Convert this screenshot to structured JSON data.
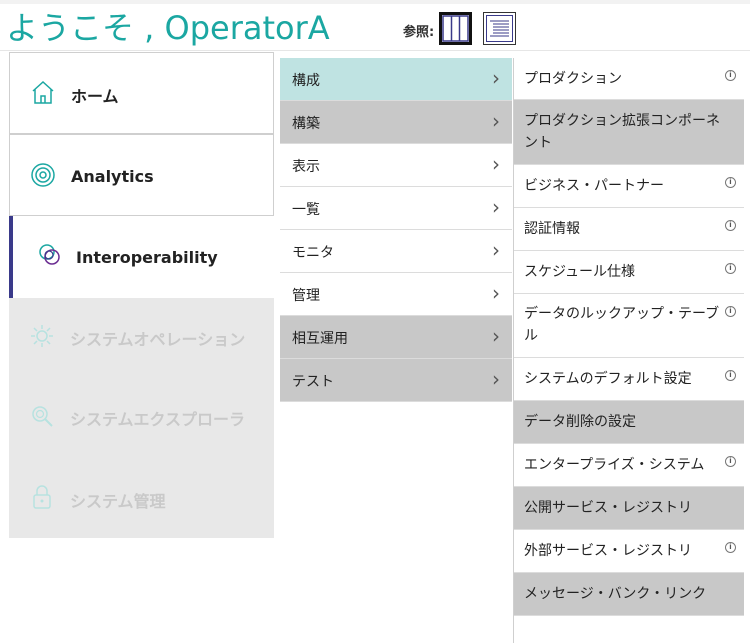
{
  "header": {
    "welcome": "ようこそ , OperatorA",
    "view_label": "参照:",
    "view_columns_icon": "columns-view-icon",
    "view_list_icon": "list-view-icon"
  },
  "left_menu": {
    "items": [
      {
        "label": "ホーム",
        "icon": "home-icon",
        "state": "enabled"
      },
      {
        "label": "Analytics",
        "icon": "analytics-target-icon",
        "state": "enabled"
      },
      {
        "label": "Interoperability",
        "icon": "interoperability-rings-icon",
        "state": "selected"
      },
      {
        "label": "システムオペレーション",
        "icon": "gear-icon",
        "state": "disabled"
      },
      {
        "label": "システムエクスプローラ",
        "icon": "magnifier-icon",
        "state": "disabled"
      },
      {
        "label": "システム管理",
        "icon": "lock-icon",
        "state": "disabled"
      }
    ]
  },
  "middle_menu": {
    "items": [
      {
        "label": "構成",
        "state": "selected"
      },
      {
        "label": "構築",
        "state": "gray"
      },
      {
        "label": "表示",
        "state": "white"
      },
      {
        "label": "一覧",
        "state": "white"
      },
      {
        "label": "モニタ",
        "state": "white"
      },
      {
        "label": "管理",
        "state": "white"
      },
      {
        "label": "相互運用",
        "state": "gray"
      },
      {
        "label": "テスト",
        "state": "gray"
      }
    ],
    "chevron": "›"
  },
  "right_menu": {
    "info_glyph": "i",
    "items": [
      {
        "label": "プロダクション",
        "state": "white",
        "info": true
      },
      {
        "label": "プロダクション拡張コンポーネント",
        "state": "gray",
        "info": false
      },
      {
        "label": "ビジネス・パートナー",
        "state": "white",
        "info": true
      },
      {
        "label": "認証情報",
        "state": "white",
        "info": true
      },
      {
        "label": "スケジュール仕様",
        "state": "white",
        "info": true
      },
      {
        "label": "データのルックアップ・テーブル",
        "state": "white",
        "info": true
      },
      {
        "label": "システムのデフォルト設定",
        "state": "white",
        "info": true
      },
      {
        "label": "データ削除の設定",
        "state": "gray",
        "info": false
      },
      {
        "label": "エンタープライズ・システム",
        "state": "white",
        "info": true
      },
      {
        "label": "公開サービス・レジストリ",
        "state": "gray",
        "info": false
      },
      {
        "label": "外部サービス・レジストリ",
        "state": "white",
        "info": true
      },
      {
        "label": "メッセージ・バンク・リンク",
        "state": "gray",
        "info": false
      }
    ]
  }
}
